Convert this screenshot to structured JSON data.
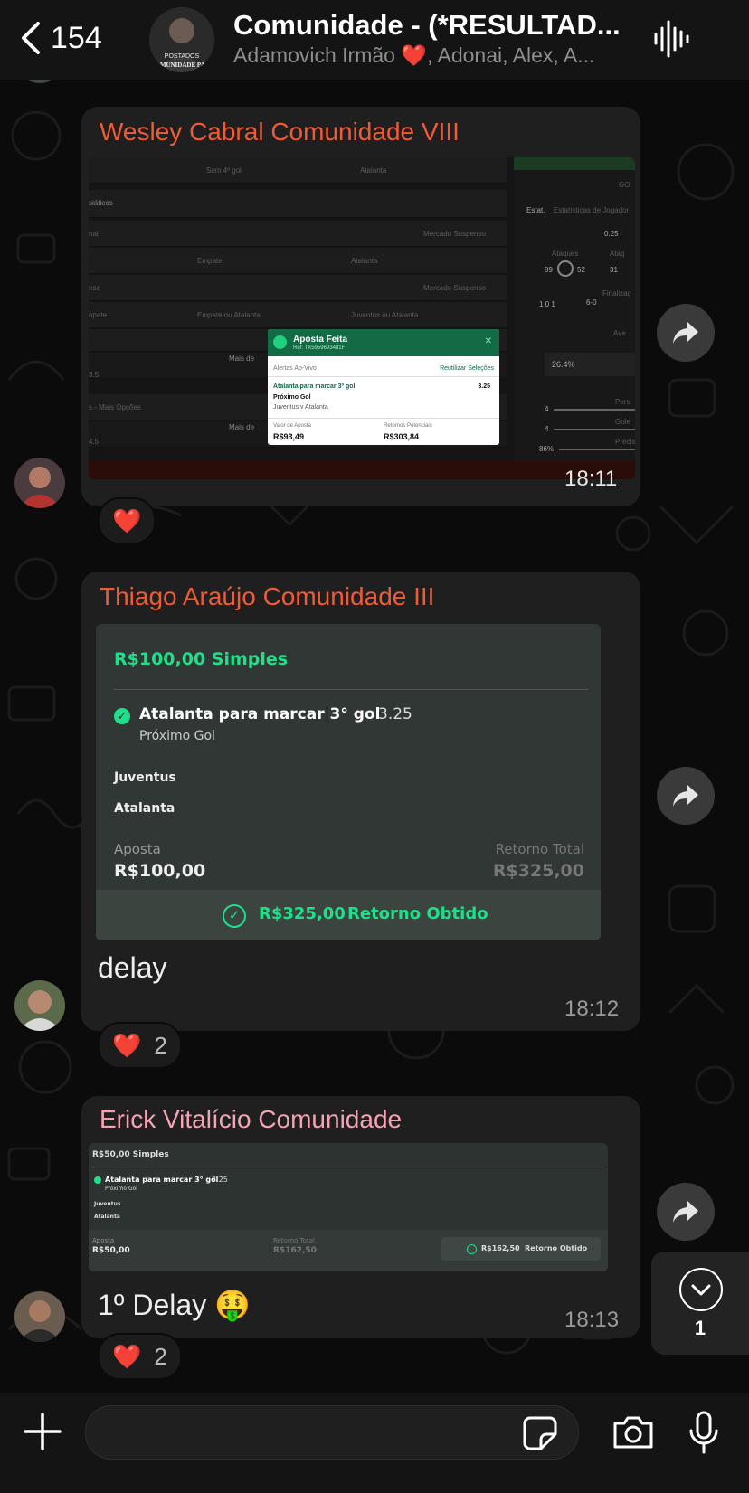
{
  "header": {
    "back_count": "154",
    "title": "Comunidade - (*RESULTAD...",
    "members": "Adamovich Irmão ❤️, Adonai, Alex, A...",
    "group_avatar_text": "COMUNIDADE PAEP",
    "group_avatar_top_text": "POSTADOS"
  },
  "messages": [
    {
      "sender": "Wesley Cabral Comunidade VIII",
      "sender_color": "#f05a35",
      "time": "18:11",
      "reaction": "❤️",
      "screenshot": {
        "rows": [
          "Sem 4º gol",
          "Atalanta",
          "siáticos",
          "nal",
          "Mercado Suspenso",
          "Empate",
          "Atalanta",
          "nse",
          "Mercado Suspenso",
          "npate",
          "Empate ou Atalanta",
          "Juventus ou Atalanta",
          "Mais de",
          "3.5",
          "s - Mais Opções",
          "Mais de",
          "4.5"
        ],
        "side": {
          "tab1": "Estat.",
          "tab2": "Estatísticas de Jogador",
          "odds": "0.25",
          "ataques": "Ataques",
          "ataq2": "Ataq",
          "v1": "89",
          "v2": "52",
          "v3": "31",
          "cards": "1 0 1",
          "score": "6-0",
          "finaliz": "Finalizaç",
          "av": "Ave",
          "pct": "26.4%",
          "r1": "4",
          "r2": "4",
          "r3": "86%",
          "pe": "Pers",
          "go": "Gole",
          "pr": "Precis",
          "gc": "GO"
        },
        "popup": {
          "title": "Aposta Feita",
          "ref": "Ref: TX5959693481F",
          "alerts": "Alertas Ao-Vivo",
          "reuse": "Reutilizar Seleções",
          "selection": "Atalanta para marcar 3º gol",
          "odds": "3.25",
          "market": "Próximo Gol",
          "match": "Juventus v Atalanta",
          "stake_label": "Valor de Aposta",
          "stake": "R$93,49",
          "returns_label": "Retornos Potenciais",
          "returns": "R$303,84"
        }
      }
    },
    {
      "sender": "Thiago Araújo Comunidade III",
      "sender_color": "#f05a35",
      "time": "18:12",
      "text": "delay",
      "reaction": "❤️",
      "reaction_count": "2",
      "card": {
        "header": "R$100,00 Simples",
        "selection": "Atalanta para marcar 3° gol",
        "odds": "3.25",
        "market": "Próximo Gol",
        "team1": "Juventus",
        "team2": "Atalanta",
        "stake_label": "Aposta",
        "stake": "R$100,00",
        "return_label": "Retorno Total",
        "return": "R$325,00",
        "footer_amount": "R$325,00",
        "footer_label": "Retorno Obtido"
      }
    },
    {
      "sender": "Erick Vitalício Comunidade",
      "sender_color": "#f4a3b3",
      "time": "18:13",
      "text": "1º Delay 🤑",
      "reaction": "❤️",
      "reaction_count": "2",
      "card": {
        "header": "R$50,00 Simples",
        "selection": "Atalanta para marcar 3° gol",
        "odds": "3.25",
        "market": "Próximo Gol",
        "team1": "Juventus",
        "team2": "Atalanta",
        "stake_label": "Aposta",
        "stake": "R$50,00",
        "return_label": "Retorno Total",
        "return": "R$162,50",
        "footer_amount": "R$162,50",
        "footer_label": "Retorno Obtido"
      }
    }
  ],
  "scroll_down": {
    "unread": "1"
  },
  "icons": [
    "back-chevron-icon",
    "waveform-icon",
    "forward-icon",
    "chevron-down-icon",
    "plus-icon",
    "sticker-icon",
    "camera-icon",
    "microphone-icon"
  ],
  "colors": {
    "accent_green": "#1fe08a",
    "bubble": "#1f1f1f",
    "header": "#141414"
  }
}
